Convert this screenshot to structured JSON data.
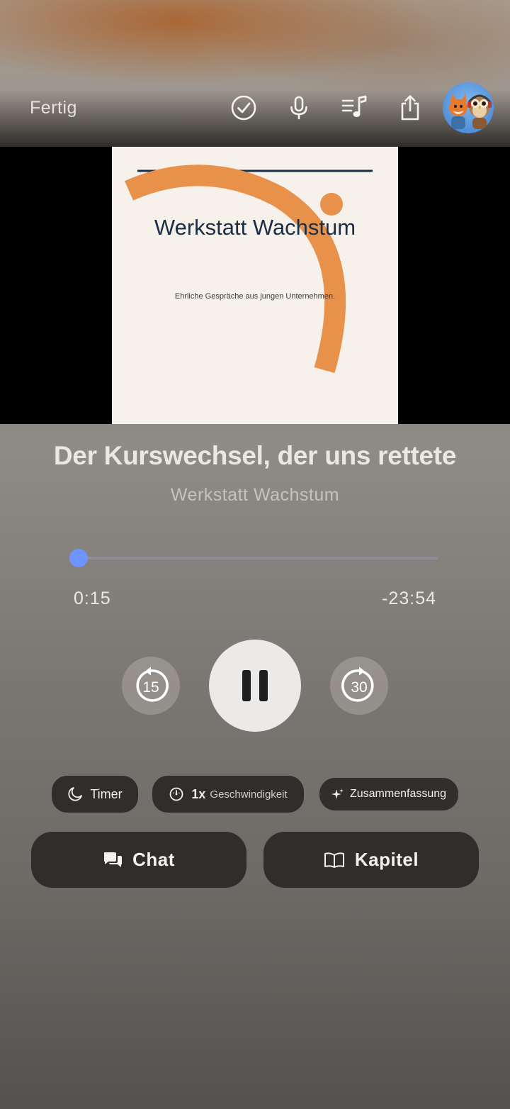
{
  "header": {
    "done_label": "Fertig",
    "icons": [
      "checkmark-circle-icon",
      "microphone-icon",
      "queue-music-icon",
      "share-icon",
      "podcast-avatar"
    ]
  },
  "cover": {
    "title": "Werkstatt Wachstum",
    "subtitle": "Ehrliche Gespräche aus jungen Unternehmen."
  },
  "episode": {
    "title": "Der Kurswechsel, der uns rettete",
    "podcast": "Werkstatt Wachstum"
  },
  "player": {
    "elapsed": "0:15",
    "remaining": "-23:54",
    "progress": 0.01,
    "skip_back": "15",
    "skip_forward": "30",
    "state": "playing"
  },
  "options": {
    "timer_label": "Timer",
    "speed_value": "1x",
    "speed_label": "Geschwindigkeit",
    "summary_label": "Zusammenfassung"
  },
  "actions": {
    "chat_label": "Chat",
    "chapters_label": "Kapitel"
  },
  "colors": {
    "accent": "#6e95ff",
    "cover_orange": "#e8914b",
    "cover_navy": "#1c2e45",
    "button_dark": "#2f2e2d"
  }
}
